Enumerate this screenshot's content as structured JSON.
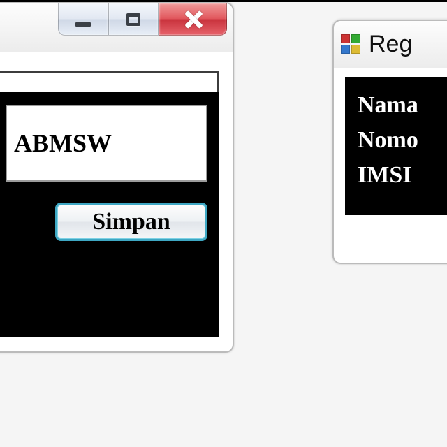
{
  "leftWindow": {
    "field_value": "ABMSW",
    "save_label": "Simpan"
  },
  "rightWindow": {
    "title": "Reg",
    "labels": {
      "nama": "Nama",
      "nomor": "Nomo",
      "imsi": "IMSI"
    }
  }
}
